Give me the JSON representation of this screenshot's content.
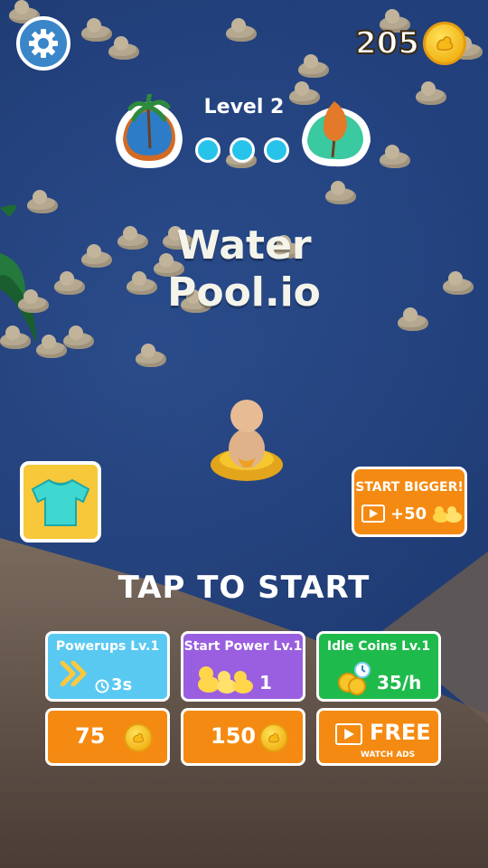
{
  "hud": {
    "coins": "205"
  },
  "level": {
    "label": "Level 2",
    "progress_dots": 3
  },
  "title": {
    "line1": "Water",
    "line2": "Pool.io"
  },
  "start_bigger": {
    "label": "START BIGGER!",
    "bonus": "+50"
  },
  "tap_to_start": "TAP TO START",
  "upgrades": [
    {
      "name": "Powerups Lv.1",
      "value": "3s",
      "price": "75",
      "color": "#59c9f2"
    },
    {
      "name": "Start Power Lv.1",
      "value": "1",
      "price": "150",
      "color": "#9a5fe0"
    },
    {
      "name": "Idle Coins Lv.1",
      "value": "35/h",
      "price": "FREE",
      "price_sub": "WATCH ADS",
      "color": "#1fba4c"
    }
  ],
  "colors": {
    "water": "#203c75",
    "sand": "#6b5a4c",
    "orange": "#f58a12",
    "yellow": "#f6c83a",
    "cyan": "#27c3ea"
  }
}
